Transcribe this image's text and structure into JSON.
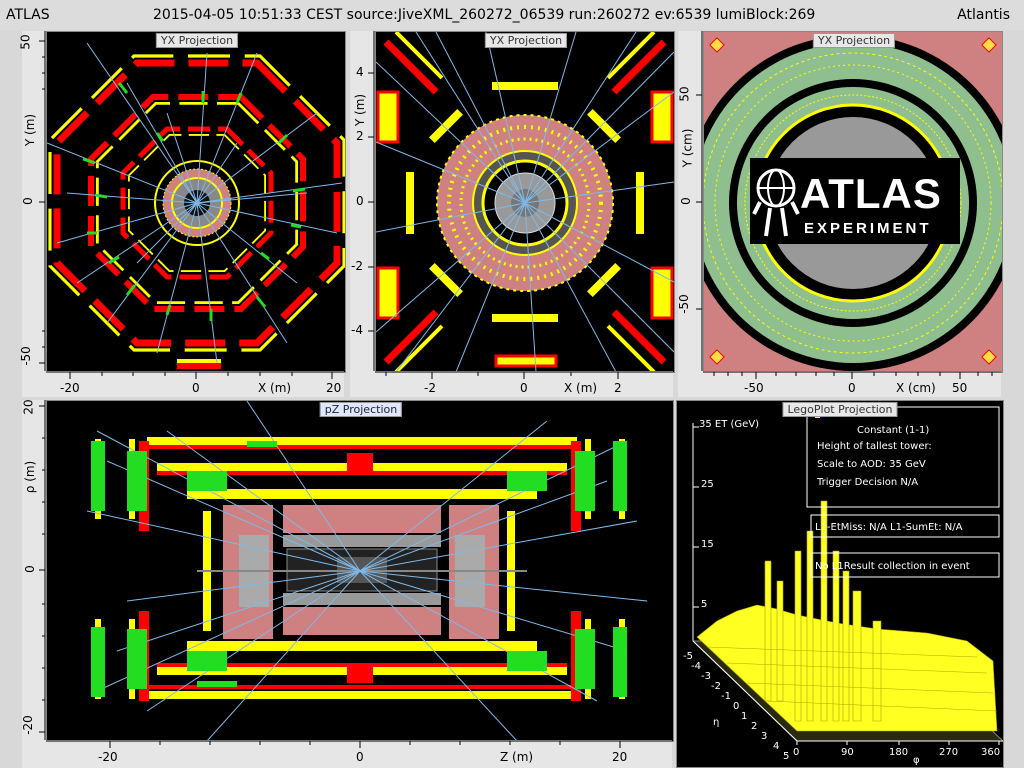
{
  "header": {
    "left": "ATLAS",
    "center": "2015-04-05 10:51:33 CEST source:JiveXML_260272_06539 run:260272 ev:6539 lumiBlock:269",
    "right": "Atlantis"
  },
  "panels": {
    "yx1": {
      "title": "YX Projection",
      "y_axis_label": "Y (m)",
      "x_axis_label": "X (m)",
      "y_ticks": [
        "50",
        "0",
        "-50"
      ],
      "x_ticks": [
        "-20",
        "0",
        "20"
      ]
    },
    "yx2": {
      "title": "YX Projection",
      "y_axis_label": "Y (m)",
      "x_axis_label": "X (m)",
      "y_ticks": [
        "4",
        "2",
        "0",
        "-2",
        "-4"
      ],
      "x_ticks": [
        "-2",
        "0",
        "2"
      ]
    },
    "yx3": {
      "title": "YX Projection",
      "y_axis_label": "Y (cm)",
      "x_axis_label": "X (cm)",
      "y_ticks": [
        "50",
        "0",
        "-50"
      ],
      "x_ticks": [
        "-50",
        "0",
        "50"
      ],
      "logo_main": "ATLAS",
      "logo_sub": "EXPERIMENT"
    },
    "pz": {
      "title": "pZ Projection",
      "y_axis_label": "ρ (m)",
      "x_axis_label": "Z (m)",
      "y_ticks": [
        "20",
        "0",
        "-20"
      ],
      "x_ticks": [
        "-20",
        "0",
        "20"
      ]
    },
    "lego": {
      "title": "LegoPlot Projection",
      "et_axis_label": "ET (GeV)",
      "et_ticks": [
        "35",
        "25",
        "15",
        "5"
      ],
      "eta_label": "η",
      "eta_ticks": [
        "-5",
        "-4",
        "-3",
        "-2",
        "-1",
        "0",
        "1",
        "2",
        "3",
        "4",
        "5"
      ],
      "phi_label": "φ",
      "phi_ticks": [
        "0",
        "90",
        "180",
        "270",
        "360"
      ],
      "legend_lines": [
        "Constant (1-1)",
        "Height of tallest tower:",
        "Scale to AOD: 35 GeV",
        "Trigger Decision N/A"
      ],
      "etmiss_text": "L1-EtMiss: N/A L1-SumEt: N/A",
      "l1result_text": "No L1Result collection in event"
    }
  },
  "colors": {
    "background": "#000000",
    "muon_yellow": "#ffff00",
    "muon_red": "#ff0000",
    "track_blue": "#7fb9ea",
    "hit_green": "#22dd22",
    "calo_pink": "#cf8080",
    "lego_yellow": "#ffff22"
  }
}
